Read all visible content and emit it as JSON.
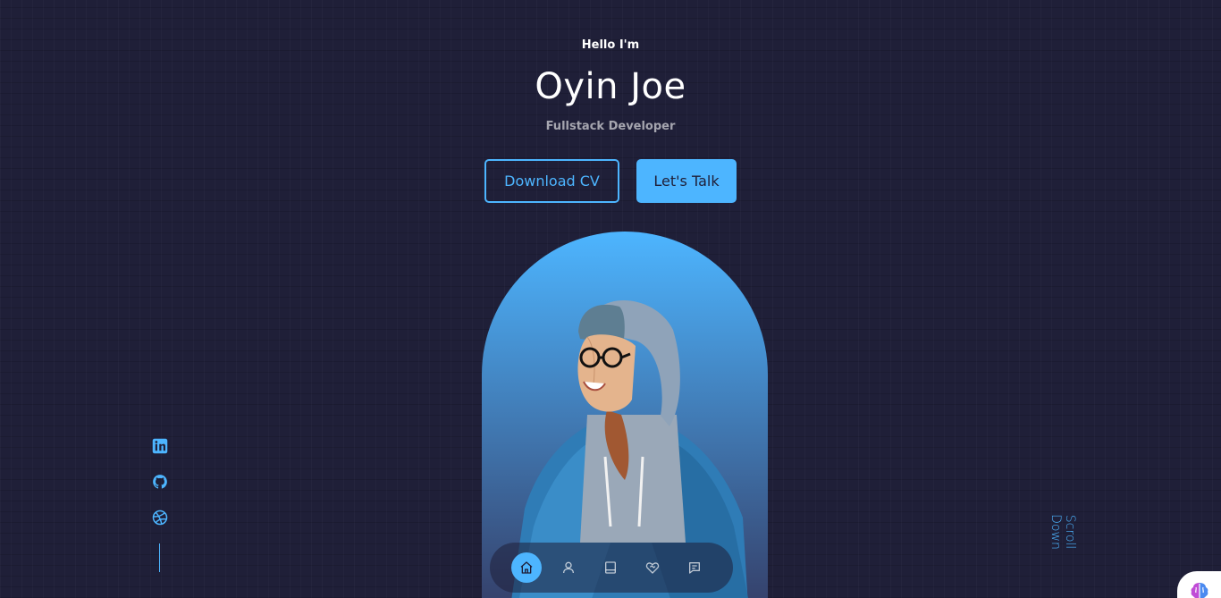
{
  "header": {
    "greeting": "Hello I'm",
    "name": "Oyin Joe",
    "role": "Fullstack Developer"
  },
  "cta": {
    "download_label": "Download CV",
    "talk_label": "Let's Talk"
  },
  "socials": [
    {
      "name": "linkedin",
      "icon": "linkedin-icon"
    },
    {
      "name": "github",
      "icon": "github-icon"
    },
    {
      "name": "dribbble",
      "icon": "dribbble-icon"
    }
  ],
  "scroll_down_label": "Scroll Down",
  "bottom_nav": [
    {
      "name": "home",
      "icon": "home-icon",
      "active": true
    },
    {
      "name": "about",
      "icon": "user-icon",
      "active": false
    },
    {
      "name": "experience",
      "icon": "book-icon",
      "active": false
    },
    {
      "name": "services",
      "icon": "handshake-icon",
      "active": false
    },
    {
      "name": "contact",
      "icon": "message-icon",
      "active": false
    }
  ],
  "colors": {
    "background": "#1f1f38",
    "primary": "#4db5ff",
    "white": "#ffffff",
    "light_text": "rgba(255,255,255,0.6)"
  }
}
